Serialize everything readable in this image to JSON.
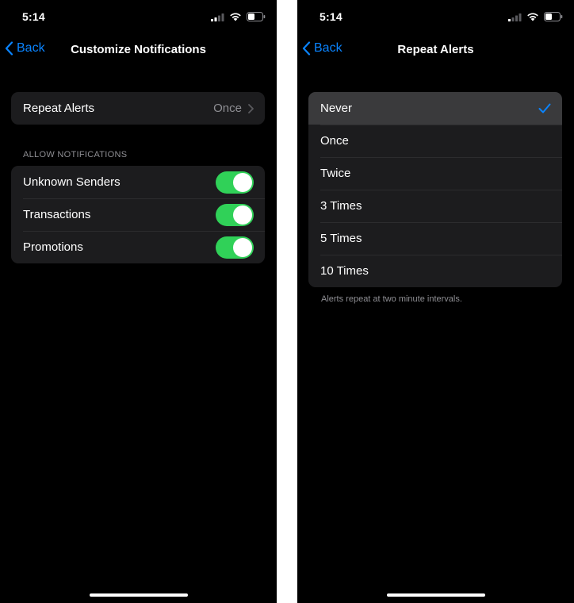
{
  "left_screen": {
    "status": {
      "time": "5:14"
    },
    "nav": {
      "back_label": "Back",
      "title": "Customize Notifications"
    },
    "repeat_row": {
      "label": "Repeat Alerts",
      "value": "Once"
    },
    "section_header": "ALLOW NOTIFICATIONS",
    "toggles": [
      {
        "label": "Unknown Senders",
        "on": true
      },
      {
        "label": "Transactions",
        "on": true
      },
      {
        "label": "Promotions",
        "on": true
      }
    ]
  },
  "right_screen": {
    "status": {
      "time": "5:14"
    },
    "nav": {
      "back_label": "Back",
      "title": "Repeat Alerts"
    },
    "options": [
      "Never",
      "Once",
      "Twice",
      "3 Times",
      "5 Times",
      "10 Times"
    ],
    "selected": "Never",
    "footer": "Alerts repeat at two minute intervals."
  },
  "colors": {
    "accent": "#0a84ff",
    "toggle_on": "#30d158",
    "group_bg": "#1c1c1e",
    "selected_bg": "#3a3a3c",
    "secondary_text": "#8e8e93"
  }
}
